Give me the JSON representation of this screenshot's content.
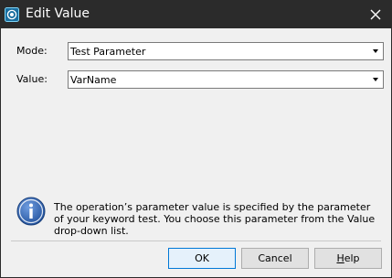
{
  "window": {
    "title": "Edit Value"
  },
  "form": {
    "mode_label": "Mode:",
    "mode_value": "Test Parameter",
    "value_label": "Value:",
    "value_value": "VarName"
  },
  "info": {
    "text": "The operation’s parameter value is specified by the parameter of your keyword test. You choose this parameter from the Value drop-down list."
  },
  "buttons": {
    "ok": "OK",
    "cancel": "Cancel",
    "help_prefix": "",
    "help_accel": "H",
    "help_suffix": "elp"
  },
  "colors": {
    "titlebar": "#2b2b2b",
    "default_button_border": "#0078d7",
    "info_icon": "#2f5fa8"
  },
  "icons": {
    "app": "teststep-icon",
    "close": "close-icon",
    "info": "info-icon",
    "dropdown": "chevron-down-icon"
  }
}
